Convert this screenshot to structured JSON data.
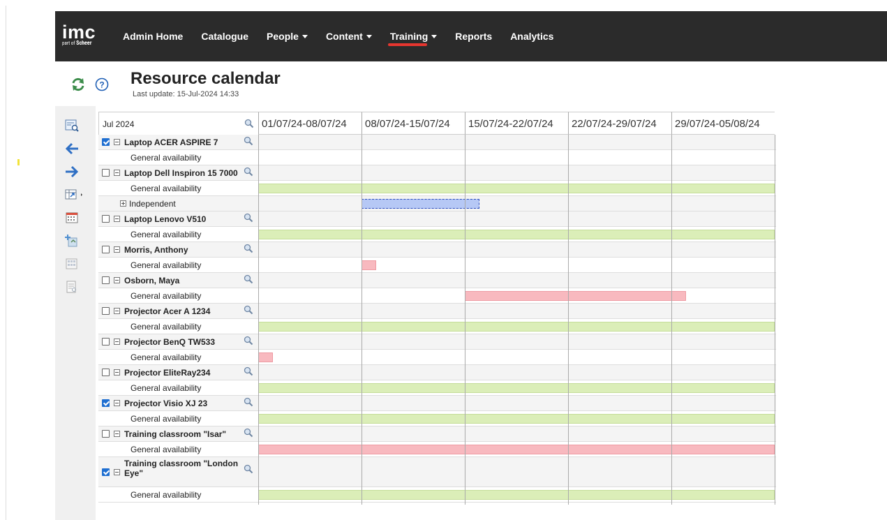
{
  "logo": {
    "main": "imc",
    "sub_prefix": "part of",
    "sub_brand": "Scheer"
  },
  "nav": [
    {
      "label": "Admin Home",
      "dropdown": false,
      "active": false
    },
    {
      "label": "Catalogue",
      "dropdown": false,
      "active": false
    },
    {
      "label": "People",
      "dropdown": true,
      "active": false
    },
    {
      "label": "Content",
      "dropdown": true,
      "active": false
    },
    {
      "label": "Training",
      "dropdown": true,
      "active": true
    },
    {
      "label": "Reports",
      "dropdown": false,
      "active": false
    },
    {
      "label": "Analytics",
      "dropdown": false,
      "active": false
    }
  ],
  "header": {
    "title": "Resource calendar",
    "last_update": "Last update: 15-Jul-2024 14:33"
  },
  "colors": {
    "nav_bg": "#2b2b2b",
    "accent": "#e6362f",
    "available": "#dbeeb8",
    "unavailable": "#f8b9bf",
    "booking": "#b6c8f5",
    "checkbox": "#1f6fd1"
  },
  "toolbar_icons": [
    "zoom-document-icon",
    "arrow-left-icon",
    "arrow-right-icon",
    "export-menu-icon",
    "calendar-icon",
    "add-resource-icon",
    "grid-icon",
    "report-icon"
  ],
  "calendar": {
    "month": "Jul 2024",
    "weeks": [
      "01/07/24-08/07/24",
      "08/07/24-15/07/24",
      "15/07/24-22/07/24",
      "22/07/24-29/07/24",
      "29/07/24-05/08/24"
    ],
    "rows": [
      {
        "type": "resource",
        "label": "Laptop ACER ASPIRE 7",
        "checked": true
      },
      {
        "type": "sub",
        "label": "General availability",
        "bars": []
      },
      {
        "type": "resource",
        "label": "Laptop Dell Inspiron 15 7000",
        "checked": false
      },
      {
        "type": "sub",
        "label": "General availability",
        "bars": [
          {
            "color": "green",
            "from": "01/07/24",
            "to": "05/08/24"
          }
        ]
      },
      {
        "type": "independent",
        "label": "Independent",
        "bars": [
          {
            "color": "blue",
            "from": "08/07/24",
            "to": "16/07/24"
          }
        ]
      },
      {
        "type": "resource",
        "label": "Laptop Lenovo V510",
        "checked": false
      },
      {
        "type": "sub",
        "label": "General availability",
        "bars": [
          {
            "color": "green",
            "from": "01/07/24",
            "to": "05/08/24"
          }
        ]
      },
      {
        "type": "resource",
        "label": "Morris, Anthony",
        "checked": false
      },
      {
        "type": "sub",
        "label": "General availability",
        "bars": [
          {
            "color": "red",
            "from": "08/07/24",
            "to": "09/07/24"
          }
        ]
      },
      {
        "type": "resource",
        "label": "Osborn, Maya",
        "checked": false
      },
      {
        "type": "sub",
        "label": "General availability",
        "bars": [
          {
            "color": "red",
            "from": "15/07/24",
            "to": "30/07/24"
          }
        ]
      },
      {
        "type": "resource",
        "label": "Projector Acer A 1234",
        "checked": false
      },
      {
        "type": "sub",
        "label": "General availability",
        "bars": [
          {
            "color": "green",
            "from": "01/07/24",
            "to": "05/08/24"
          }
        ]
      },
      {
        "type": "resource",
        "label": "Projector BenQ TW533",
        "checked": false
      },
      {
        "type": "sub",
        "label": "General availability",
        "bars": [
          {
            "color": "red",
            "from": "01/07/24",
            "to": "02/07/24"
          }
        ]
      },
      {
        "type": "resource",
        "label": "Projector EliteRay234",
        "checked": false
      },
      {
        "type": "sub",
        "label": "General availability",
        "bars": [
          {
            "color": "green",
            "from": "01/07/24",
            "to": "05/08/24"
          }
        ]
      },
      {
        "type": "resource",
        "label": "Projector Visio XJ 23",
        "checked": true
      },
      {
        "type": "sub",
        "label": "General availability",
        "bars": [
          {
            "color": "green",
            "from": "01/07/24",
            "to": "05/08/24"
          }
        ]
      },
      {
        "type": "resource",
        "label": "Training classroom \"Isar\"",
        "checked": false
      },
      {
        "type": "sub",
        "label": "General availability",
        "bars": [
          {
            "color": "red",
            "from": "01/07/24",
            "to": "05/08/24"
          }
        ]
      },
      {
        "type": "resource",
        "label": "Training classroom \"London Eye\"",
        "checked": true
      },
      {
        "type": "sub",
        "label": "General availability",
        "bars": [
          {
            "color": "green",
            "from": "01/07/24",
            "to": "05/08/24"
          }
        ]
      }
    ]
  }
}
